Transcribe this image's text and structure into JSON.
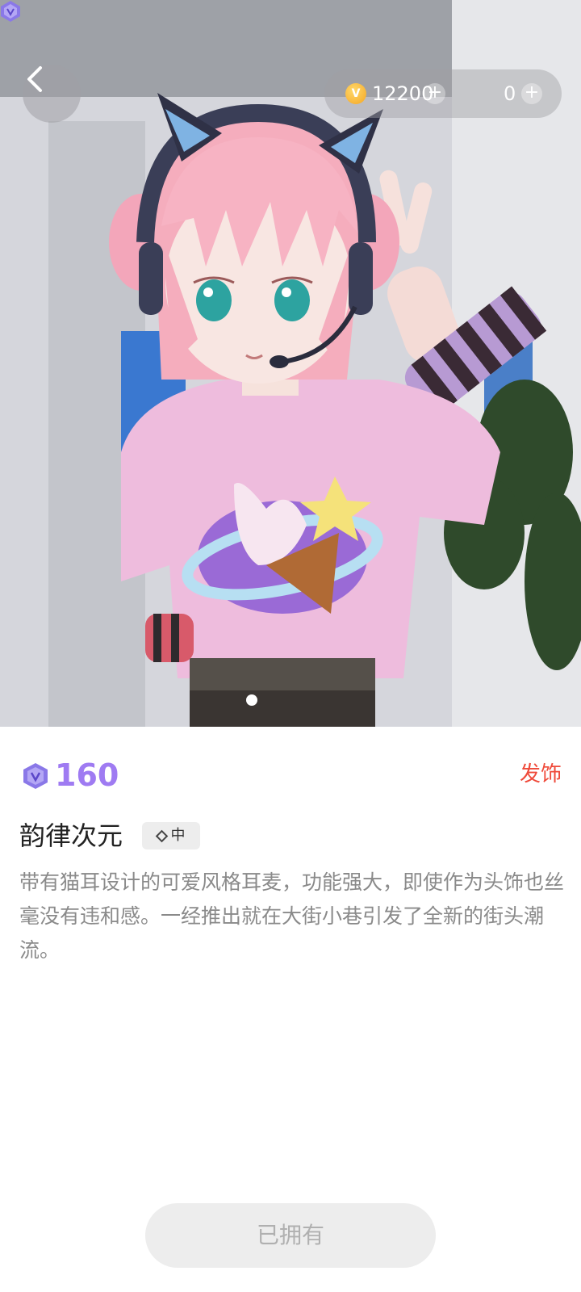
{
  "header": {
    "back_label": "back",
    "coins": {
      "icon": "coin-icon",
      "symbol": "V",
      "amount": "12200"
    },
    "gems": {
      "icon": "gem-icon",
      "amount": "0"
    },
    "plus_symbol": "+"
  },
  "preview": {
    "image_subject": "avatar-model-preview",
    "current_page": 1,
    "page_count": 1
  },
  "item": {
    "price_icon": "gem-icon",
    "price": "160",
    "category": "发饰",
    "name": "韵律次元",
    "rarity_label": "中",
    "description": "带有猫耳设计的可爱风格耳麦，功能强大，即使作为头饰也丝毫没有违和感。一经推出就在大街小巷引发了全新的街头潮流。"
  },
  "action": {
    "button_label": "已拥有"
  },
  "colors": {
    "price_accent": "#9f7bf2",
    "category_text": "#ef4a3a",
    "button_bg": "#ededed",
    "button_text": "#b0b0b0"
  }
}
